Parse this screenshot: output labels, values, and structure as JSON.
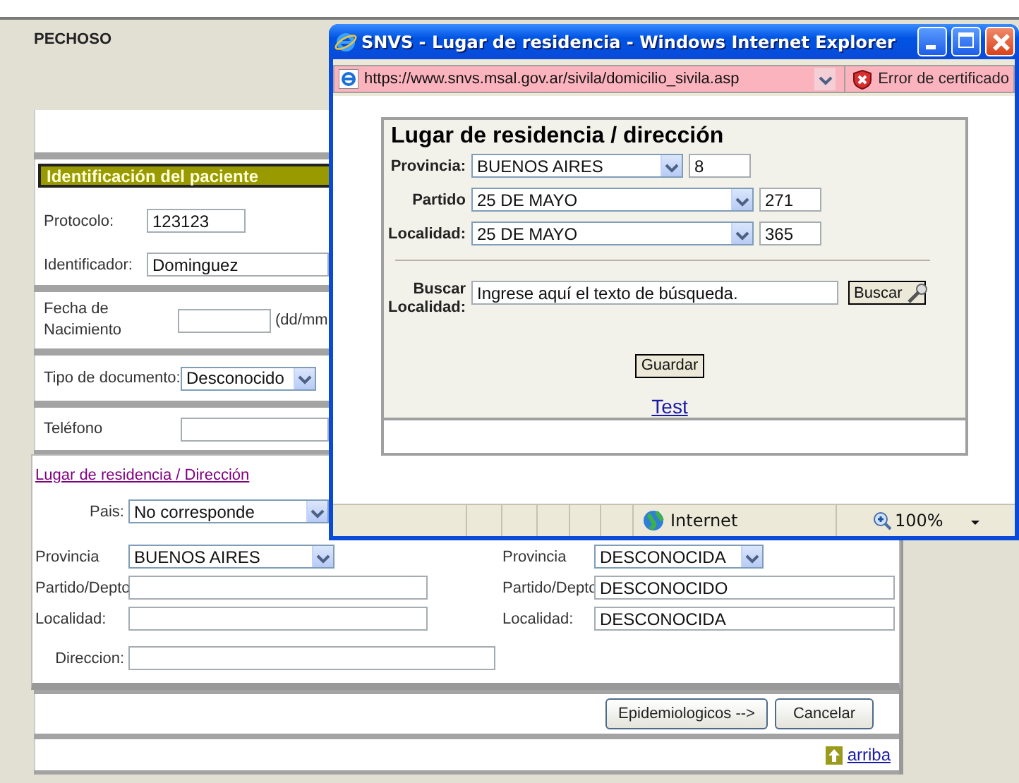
{
  "form": {
    "partial_heading": "PECHOSO",
    "section_title": "Identificación del paciente",
    "protocolo": {
      "label": "Protocolo:",
      "value": "123123"
    },
    "identificador": {
      "label": "Identificador:",
      "value": "Dominguez"
    },
    "fecha": {
      "label": "Fecha de Nacimiento",
      "hint": "(dd/mm"
    },
    "tipo_documento": {
      "label": "Tipo de documento:",
      "value": "Desconocido"
    },
    "telefono": {
      "label": "Teléfono"
    },
    "residence": {
      "link": "Lugar de residencia / Dirección",
      "pais": {
        "label": "Pais:",
        "value": "No corresponde"
      },
      "left": [
        {
          "kind": "select",
          "label": "Provincia",
          "value": "BUENOS AIRES"
        },
        {
          "kind": "input",
          "label": "Partido/Depto"
        },
        {
          "kind": "input",
          "label": "Localidad:"
        }
      ],
      "right": [
        {
          "kind": "select",
          "label": "Provincia",
          "value": "DESCONOCIDA"
        },
        {
          "kind": "input",
          "label": "Partido/Depto",
          "value": "DESCONOCIDO"
        },
        {
          "kind": "input",
          "label": "Localidad:",
          "value": "DESCONOCIDA"
        }
      ],
      "direccion": {
        "label": "Direccion:"
      }
    },
    "buttons": [
      "Epidemiologicos -->",
      "Cancelar"
    ],
    "top_link": "arriba"
  },
  "popup": {
    "title": "SNVS - Lugar de residencia - Windows Internet Explorer",
    "address": "https://www.snvs.msal.gov.ar/sivila/domicilio_sivila.asp",
    "certificate": "Error de certificado",
    "heading": "Lugar de residencia / dirección",
    "rows": [
      {
        "label": "Provincia:",
        "value": "BUENOS AIRES",
        "code": "8"
      },
      {
        "label": "Partido",
        "value": "25 DE MAYO",
        "code": "271"
      },
      {
        "label": "Localidad:",
        "value": "25 DE MAYO",
        "code": "365"
      }
    ],
    "search": {
      "label": "Buscar Localidad:",
      "value": "Ingrese aquí el texto de búsqueda.",
      "button": "Buscar"
    },
    "save_button": "Guardar",
    "link": "Test",
    "status": {
      "zone": "Internet",
      "zoom": "100%"
    }
  }
}
